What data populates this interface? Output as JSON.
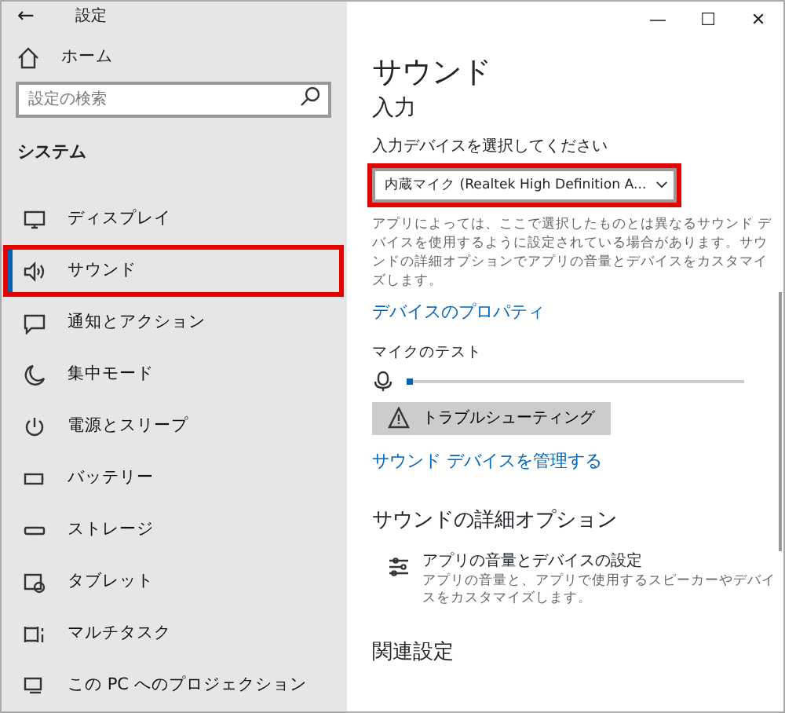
{
  "window": {
    "title": "設定",
    "back": "←",
    "controls": [
      "—",
      "☐",
      "✕"
    ]
  },
  "sidebar": {
    "home": "ホーム",
    "search": {
      "placeholder": "設定の検索"
    },
    "section": "システム",
    "items": [
      {
        "label": "ディスプレイ",
        "selected": false,
        "highlighted": false
      },
      {
        "label": "サウンド",
        "selected": true,
        "highlighted": true
      },
      {
        "label": "通知とアクション",
        "selected": false,
        "highlighted": false
      },
      {
        "label": "集中モード",
        "selected": false,
        "highlighted": false
      },
      {
        "label": "電源とスリープ",
        "selected": false,
        "highlighted": false
      },
      {
        "label": "バッテリー",
        "selected": false,
        "highlighted": false
      },
      {
        "label": "ストレージ",
        "selected": false,
        "highlighted": false
      },
      {
        "label": "タブレット",
        "selected": false,
        "highlighted": false
      },
      {
        "label": "マルチタスク",
        "selected": false,
        "highlighted": false
      },
      {
        "label": "この PC へのプロジェクション",
        "selected": false,
        "highlighted": false
      }
    ]
  },
  "content": {
    "title": "サウンド",
    "input_heading": "入力",
    "device_label": "入力デバイスを選択してください",
    "device_dropdown": {
      "value": "内蔵マイク (Realtek High Definition A...",
      "highlighted": true
    },
    "description": "アプリによっては、ここで選択したものとは異なるサウンド デバイスを使用するように設定されている場合があります。サウンドの詳細オプションでアプリの音量とデバイスをカスタマイズします。",
    "properties_link": "デバイスのプロパティ",
    "mic_test_label": "マイクのテスト",
    "mic_level": {
      "level": 0.02
    },
    "troubleshoot_button": "トラブルシューティング",
    "manage_link": "サウンド デバイスを管理する",
    "advanced_heading": "サウンドの詳細オプション",
    "advanced_option": {
      "title": "アプリの音量とデバイスの設定",
      "description": "アプリの音量と、アプリで使用するスピーカーやデバイスをカスタマイズします。"
    },
    "related_heading": "関連設定"
  }
}
